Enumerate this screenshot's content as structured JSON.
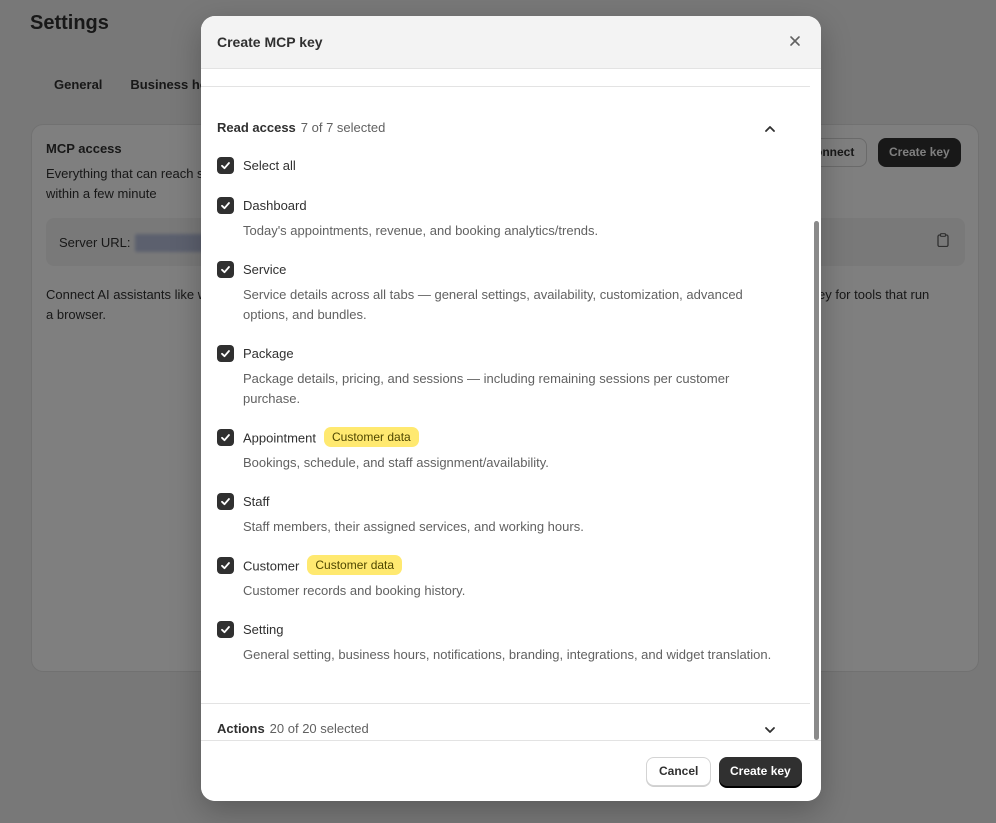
{
  "page": {
    "title": "Settings",
    "tabs": [
      "General",
      "Business hou"
    ],
    "card": {
      "title": "MCP access",
      "desc": "Everything that can reach stops within a few minute",
      "connect_label": "onnect",
      "create_key_label": "Create key",
      "server_label": "Server URL:",
      "body_left": "Connect AI assistants like without a browser.",
      "body_right": "ey for tools that run"
    }
  },
  "modal": {
    "title": "Create MCP key",
    "read_access": {
      "title": "Read access",
      "count": "7 of 7 selected",
      "select_all": "Select all",
      "items": [
        {
          "label": "Dashboard",
          "desc": "Today's appointments, revenue, and booking analytics/trends.",
          "badge": ""
        },
        {
          "label": "Service",
          "desc": "Service details across all tabs — general settings, availability, customization, advanced options, and bundles.",
          "badge": ""
        },
        {
          "label": "Package",
          "desc": "Package details, pricing, and sessions — including remaining sessions per customer purchase.",
          "badge": ""
        },
        {
          "label": "Appointment",
          "desc": "Bookings, schedule, and staff assignment/availability.",
          "badge": "Customer data"
        },
        {
          "label": "Staff",
          "desc": "Staff members, their assigned services, and working hours.",
          "badge": ""
        },
        {
          "label": "Customer",
          "desc": "Customer records and booking history.",
          "badge": "Customer data"
        },
        {
          "label": "Setting",
          "desc": "General setting, business hours, notifications, branding, integrations, and widget translation.",
          "badge": ""
        }
      ]
    },
    "actions": {
      "title": "Actions",
      "count": "20 of 20 selected"
    },
    "cancel_label": "Cancel",
    "create_label": "Create key"
  }
}
